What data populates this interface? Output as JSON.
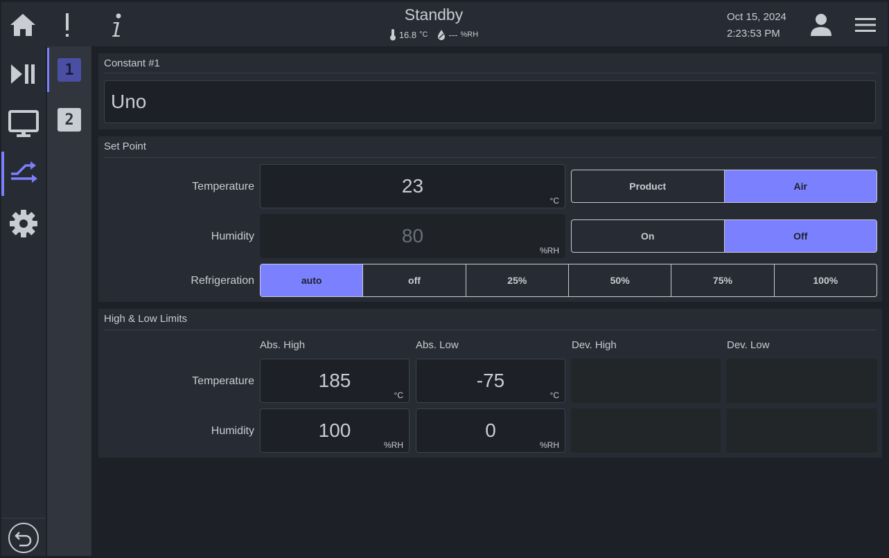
{
  "header": {
    "status": "Standby",
    "temperature": "16.8",
    "temperature_unit": "°C",
    "humidity": "---",
    "humidity_unit": "%RH",
    "date": "Oct 15, 2024",
    "time": "2:23:53 PM"
  },
  "icons": {
    "home": "home-icon",
    "alert": "exclamation-icon",
    "info": "info-icon",
    "user": "user-icon",
    "menu": "hamburger-icon",
    "play_pause": "play-pause-icon",
    "monitor": "monitor-icon",
    "profile": "profile-icon",
    "settings": "gear-icon",
    "back": "back-arrow-icon"
  },
  "nav": {
    "active": "profile"
  },
  "constants": {
    "items": [
      "1",
      "2"
    ],
    "selected": "1"
  },
  "constant_panel": {
    "title": "Constant #1",
    "name_value": "Uno"
  },
  "setpoint": {
    "title": "Set Point",
    "temperature": {
      "label": "Temperature",
      "value": "23",
      "unit": "°C",
      "mode_options": [
        "Product",
        "Air"
      ],
      "mode_selected": "Air"
    },
    "humidity": {
      "label": "Humidity",
      "value": "80",
      "unit": "%RH",
      "toggle_options": [
        "On",
        "Off"
      ],
      "toggle_selected": "Off"
    },
    "refrigeration": {
      "label": "Refrigeration",
      "options": [
        "auto",
        "off",
        "25%",
        "50%",
        "75%",
        "100%"
      ],
      "selected": "auto"
    }
  },
  "limits": {
    "title": "High & Low Limits",
    "columns": [
      "Abs. High",
      "Abs. Low",
      "Dev. High",
      "Dev. Low"
    ],
    "rows": [
      {
        "label": "Temperature",
        "abs_high": "185",
        "abs_low": "-75",
        "unit": "°C"
      },
      {
        "label": "Humidity",
        "abs_high": "100",
        "abs_low": "0",
        "unit": "%RH"
      }
    ]
  },
  "colors": {
    "accent": "#7b80ff",
    "background": "#1d2026",
    "panel": "#272b33",
    "text": "#c9ccd2"
  }
}
